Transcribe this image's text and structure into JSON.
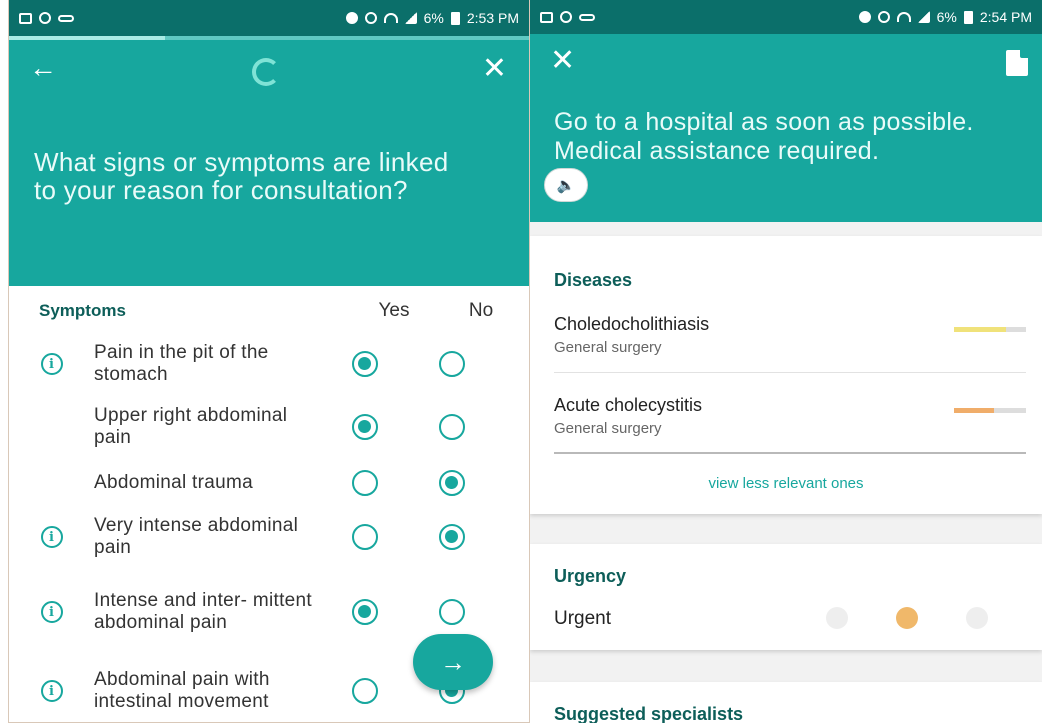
{
  "left": {
    "statusbar": {
      "time": "2:53 PM",
      "battery": "6%"
    },
    "progress_fraction": 0.3,
    "question": "What signs or symptoms are linked to your reason for consultation?",
    "table": {
      "title": "Symptoms",
      "yes_label": "Yes",
      "no_label": "No"
    },
    "symptoms": [
      {
        "label": "Pain in the pit of the stomach",
        "info": true,
        "answer": "yes"
      },
      {
        "label": "Upper right abdominal pain",
        "info": false,
        "answer": "yes"
      },
      {
        "label": "Abdominal trauma",
        "info": false,
        "answer": "no"
      },
      {
        "label": "Very intense abdominal pain",
        "info": true,
        "answer": "no"
      },
      {
        "label": "Intense and inter- mittent abdominal pain",
        "info": true,
        "answer": "yes"
      },
      {
        "label": "Abdominal pain with intestinal movement",
        "info": true,
        "answer": "no"
      }
    ],
    "next_icon": "→"
  },
  "right": {
    "statusbar": {
      "time": "2:54 PM",
      "battery": "6%"
    },
    "advice_line1": "Go to a hospital as soon as possible.",
    "advice_line2": "Medical assistance required.",
    "speaker_icon": "🔈",
    "diseases_title": "Diseases",
    "diseases": [
      {
        "name": "Choledocholithiasis",
        "specialty": "General surgery",
        "relevance": 0.72,
        "color": "#f0e27a"
      },
      {
        "name": "Acute cholecystitis",
        "specialty": "General surgery",
        "relevance": 0.55,
        "color": "#f0ad6a"
      }
    ],
    "view_less": "view less relevant ones",
    "urgency_title": "Urgency",
    "urgency_value": "Urgent",
    "urgency_level": 2,
    "urgency_color": "#f0b86a",
    "specialists_title": "Suggested specialists"
  },
  "colors": {
    "teal": "#17a79e",
    "dark_teal": "#0b6f6a"
  }
}
